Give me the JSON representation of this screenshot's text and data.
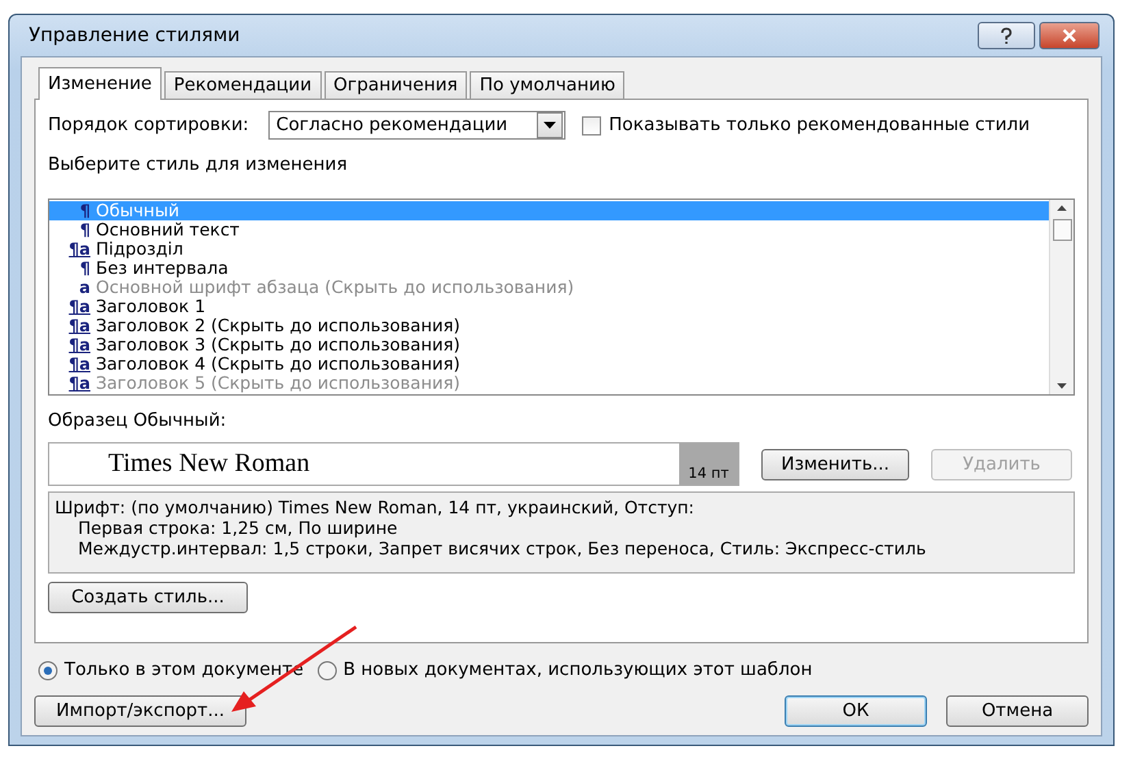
{
  "window": {
    "title": "Управление стилями"
  },
  "tabs": [
    {
      "label": "Изменение",
      "selected": true
    },
    {
      "label": "Рекомендации",
      "selected": false
    },
    {
      "label": "Ограничения",
      "selected": false
    },
    {
      "label": "По умолчанию",
      "selected": false
    }
  ],
  "sort": {
    "label": "Порядок сортировки:",
    "value": "Согласно рекомендации"
  },
  "show_recommended": {
    "label": "Показывать только рекомендованные стили",
    "checked": false
  },
  "list_label": "Выберите стиль для изменения",
  "styles": [
    {
      "kind": "paragraph",
      "glyph": "¶",
      "name": "Обычный",
      "selected": true,
      "dimmed": false
    },
    {
      "kind": "paragraph",
      "glyph": "¶",
      "name": "Основний текст",
      "selected": false,
      "dimmed": false
    },
    {
      "kind": "linked",
      "glyph": "¶a",
      "name": "Підрозділ",
      "selected": false,
      "dimmed": false
    },
    {
      "kind": "paragraph",
      "glyph": "¶",
      "name": "Без интервала",
      "selected": false,
      "dimmed": false
    },
    {
      "kind": "character",
      "glyph": "a",
      "name": "Основной шрифт абзаца  (Скрыть до использования)",
      "selected": false,
      "dimmed": true
    },
    {
      "kind": "linked",
      "glyph": "¶a",
      "name": "Заголовок 1",
      "selected": false,
      "dimmed": false
    },
    {
      "kind": "linked",
      "glyph": "¶a",
      "name": "Заголовок 2  (Скрыть до использования)",
      "selected": false,
      "dimmed": false
    },
    {
      "kind": "linked",
      "glyph": "¶a",
      "name": "Заголовок 3  (Скрыть до использования)",
      "selected": false,
      "dimmed": false
    },
    {
      "kind": "linked",
      "glyph": "¶a",
      "name": "Заголовок 4  (Скрыть до использования)",
      "selected": false,
      "dimmed": false
    },
    {
      "kind": "linked",
      "glyph": "¶a",
      "name": "Заголовок 5  (Скрыть до использования)",
      "selected": false,
      "dimmed": true
    }
  ],
  "preview": {
    "label": "Образец Обычный:",
    "font_sample": "Times New Roman",
    "size": "14 пт"
  },
  "modify_button": {
    "label": "Изменить...",
    "disabled": false
  },
  "delete_button": {
    "label": "Удалить",
    "disabled": true
  },
  "description": [
    "Шрифт: (по умолчанию) Times New Roman, 14 пт, украинский, Отступ:",
    "Первая строка:  1,25 см, По ширине",
    "Междустр.интервал:  1,5 строки, Запрет висячих строк, Без переноса, Стиль: Экспресс-стиль"
  ],
  "new_style_button": "Создать стиль...",
  "scope": [
    {
      "label": "Только в этом документе",
      "selected": true
    },
    {
      "label": "В новых документах, использующих этот шаблон",
      "selected": false
    }
  ],
  "import_button": "Импорт/экспорт...",
  "ok_button": "ОК",
  "cancel_button": "Отмена"
}
